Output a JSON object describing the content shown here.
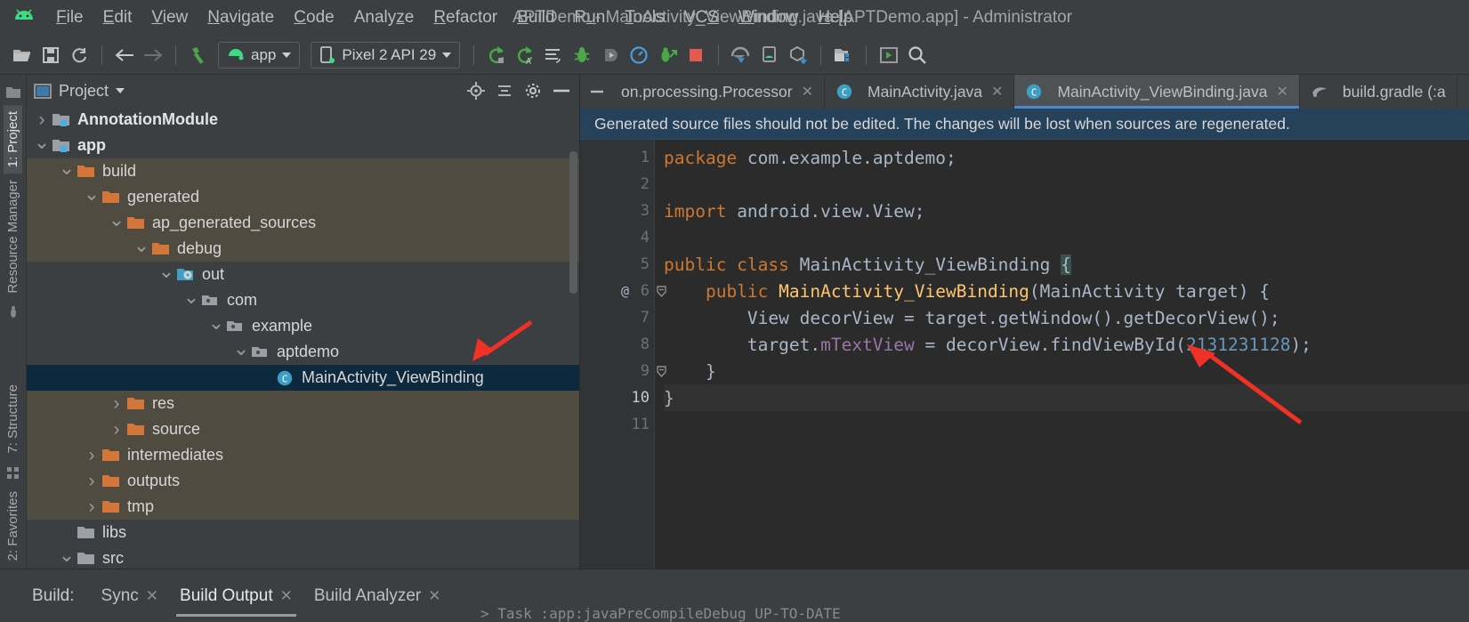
{
  "window": {
    "title": "APTDemo - MainActivity_ViewBinding.java [APTDemo.app] - Administrator",
    "logo_icon": "android-logo-icon"
  },
  "menubar": {
    "items": [
      {
        "label": "File",
        "mnemonic": "F"
      },
      {
        "label": "Edit",
        "mnemonic": "E"
      },
      {
        "label": "View",
        "mnemonic": "V"
      },
      {
        "label": "Navigate",
        "mnemonic": "N"
      },
      {
        "label": "Code",
        "mnemonic": "C"
      },
      {
        "label": "Analyze",
        "mnemonic": "z"
      },
      {
        "label": "Refactor",
        "mnemonic": "R"
      },
      {
        "label": "Build",
        "mnemonic": "B"
      },
      {
        "label": "Run",
        "mnemonic": "u"
      },
      {
        "label": "Tools",
        "mnemonic": "T"
      },
      {
        "label": "VCS",
        "mnemonic": "S"
      },
      {
        "label": "Window",
        "mnemonic": "W"
      },
      {
        "label": "Help",
        "mnemonic": "H"
      }
    ]
  },
  "toolbar": {
    "buttons": [
      {
        "name": "open-project-icon",
        "title": "Open"
      },
      {
        "name": "save-all-icon",
        "title": "Save All"
      },
      {
        "name": "sync-project-icon",
        "title": "Sync Project with Gradle Files"
      },
      {
        "name": "navigate-back-icon",
        "title": "Back"
      },
      {
        "name": "navigate-forward-icon",
        "title": "Forward"
      },
      {
        "name": "build-hammer-icon",
        "title": "Make Project"
      },
      {
        "name": "run-icon",
        "title": "Run"
      },
      {
        "name": "apply-changes-icon",
        "title": "Apply Changes"
      },
      {
        "name": "apply-code-changes-icon",
        "title": "Apply Code Changes"
      },
      {
        "name": "debug-icon",
        "title": "Debug"
      },
      {
        "name": "attach-debugger-icon",
        "title": "Attach Debugger"
      },
      {
        "name": "profiler-icon",
        "title": "Profile"
      },
      {
        "name": "run-with-coverage-icon",
        "title": "Run with Coverage"
      },
      {
        "name": "stop-icon",
        "title": "Stop"
      },
      {
        "name": "avd-manager-icon",
        "title": "AVD Manager"
      },
      {
        "name": "sdk-manager-icon",
        "title": "SDK Manager"
      },
      {
        "name": "gradle-sync-icon",
        "title": "Gradle"
      },
      {
        "name": "project-structure-icon",
        "title": "Project Structure"
      },
      {
        "name": "layout-inspector-icon",
        "title": "Layout Inspector"
      },
      {
        "name": "search-everywhere-icon",
        "title": "Search Everywhere"
      }
    ],
    "module_selector": {
      "label": "app",
      "icon": "android-module-icon"
    },
    "device_selector": {
      "label": "Pixel 2 API 29",
      "icon": "device-icon"
    }
  },
  "left_strip": {
    "tabs": [
      {
        "label": "1: Project",
        "active": true
      },
      {
        "label": "Resource Manager",
        "active": false
      },
      {
        "label": "7: Structure",
        "active": false
      },
      {
        "label": "2: Favorites",
        "active": false
      }
    ]
  },
  "project_panel": {
    "title": "Project",
    "title_icon": "project-view-icon",
    "actions": [
      {
        "name": "locate-icon"
      },
      {
        "name": "collapse-all-icon"
      },
      {
        "name": "settings-gear-icon"
      },
      {
        "name": "hide-panel-icon"
      }
    ],
    "tree": [
      {
        "label": "AnnotationModule",
        "depth": 1,
        "arrow": "right",
        "icon": "module-folder-icon",
        "bold": true,
        "bg": "none",
        "selected": false
      },
      {
        "label": "app",
        "depth": 1,
        "arrow": "down",
        "icon": "module-folder-icon",
        "bold": true,
        "bg": "none",
        "selected": false
      },
      {
        "label": "build",
        "depth": 2,
        "arrow": "down",
        "icon": "orange-folder-icon",
        "bold": false,
        "bg": "olive",
        "selected": false
      },
      {
        "label": "generated",
        "depth": 3,
        "arrow": "down",
        "icon": "orange-folder-icon",
        "bold": false,
        "bg": "olive",
        "selected": false
      },
      {
        "label": "ap_generated_sources",
        "depth": 4,
        "arrow": "down",
        "icon": "orange-folder-icon",
        "bold": false,
        "bg": "olive",
        "selected": false
      },
      {
        "label": "debug",
        "depth": 5,
        "arrow": "down",
        "icon": "orange-folder-icon",
        "bold": false,
        "bg": "olive",
        "selected": false
      },
      {
        "label": "out",
        "depth": 6,
        "arrow": "down",
        "icon": "source-root-folder-icon",
        "bold": false,
        "bg": "none",
        "selected": false
      },
      {
        "label": "com",
        "depth": 7,
        "arrow": "down",
        "icon": "package-folder-icon",
        "bold": false,
        "bg": "none",
        "selected": false
      },
      {
        "label": "example",
        "depth": 8,
        "arrow": "down",
        "icon": "package-folder-icon",
        "bold": false,
        "bg": "none",
        "selected": false
      },
      {
        "label": "aptdemo",
        "depth": 9,
        "arrow": "down",
        "icon": "package-folder-icon",
        "bold": false,
        "bg": "none",
        "selected": false
      },
      {
        "label": "MainActivity_ViewBinding",
        "depth": 10,
        "arrow": "none",
        "icon": "java-class-icon",
        "bold": false,
        "bg": "none",
        "selected": true
      },
      {
        "label": "res",
        "depth": 4,
        "arrow": "right",
        "icon": "orange-folder-icon",
        "bold": false,
        "bg": "olive",
        "selected": false
      },
      {
        "label": "source",
        "depth": 4,
        "arrow": "right",
        "icon": "orange-folder-icon",
        "bold": false,
        "bg": "olive",
        "selected": false
      },
      {
        "label": "intermediates",
        "depth": 3,
        "arrow": "right",
        "icon": "orange-folder-icon",
        "bold": false,
        "bg": "olive",
        "selected": false
      },
      {
        "label": "outputs",
        "depth": 3,
        "arrow": "right",
        "icon": "orange-folder-icon",
        "bold": false,
        "bg": "olive",
        "selected": false
      },
      {
        "label": "tmp",
        "depth": 3,
        "arrow": "right",
        "icon": "orange-folder-icon",
        "bold": false,
        "bg": "olive",
        "selected": false
      },
      {
        "label": "libs",
        "depth": 2,
        "arrow": "none",
        "icon": "gray-folder-icon",
        "bold": false,
        "bg": "none",
        "selected": false
      },
      {
        "label": "src",
        "depth": 2,
        "arrow": "down",
        "icon": "gray-folder-icon",
        "bold": false,
        "bg": "none",
        "selected": false
      }
    ]
  },
  "editor": {
    "tabs": [
      {
        "label": "on.processing.Processor",
        "icon": "none",
        "active": false,
        "closable": true
      },
      {
        "label": "MainActivity.java",
        "icon": "java-class-icon",
        "active": false,
        "closable": true
      },
      {
        "label": "MainActivity_ViewBinding.java",
        "icon": "java-class-icon",
        "active": true,
        "closable": true
      },
      {
        "label": "build.gradle (:a",
        "icon": "gradle-icon",
        "active": false,
        "closable": false
      }
    ],
    "banner": "Generated source files should not be edited. The changes will be lost when sources are regenerated.",
    "lines": [
      {
        "num": "1",
        "annotation": "",
        "fold": false,
        "current": false,
        "tokens": [
          {
            "t": "package ",
            "c": "kw"
          },
          {
            "t": "com.example.aptdemo;",
            "c": "plain"
          }
        ]
      },
      {
        "num": "2",
        "annotation": "",
        "fold": false,
        "current": false,
        "tokens": []
      },
      {
        "num": "3",
        "annotation": "",
        "fold": false,
        "current": false,
        "tokens": [
          {
            "t": "import ",
            "c": "kw"
          },
          {
            "t": "android.view.View;",
            "c": "plain"
          }
        ]
      },
      {
        "num": "4",
        "annotation": "",
        "fold": false,
        "current": false,
        "tokens": []
      },
      {
        "num": "5",
        "annotation": "",
        "fold": false,
        "current": false,
        "tokens": [
          {
            "t": "public class ",
            "c": "kw"
          },
          {
            "t": "MainActivity_ViewBinding ",
            "c": "plain"
          },
          {
            "t": "{",
            "c": "brace-hl"
          }
        ]
      },
      {
        "num": "6",
        "annotation": "@",
        "fold": true,
        "current": false,
        "tokens": [
          {
            "t": "    ",
            "c": "plain"
          },
          {
            "t": "public ",
            "c": "kw"
          },
          {
            "t": "MainActivity_ViewBinding",
            "c": "fn"
          },
          {
            "t": "(MainActivity target) {",
            "c": "plain"
          }
        ]
      },
      {
        "num": "7",
        "annotation": "",
        "fold": false,
        "current": false,
        "tokens": [
          {
            "t": "        View decorView = target.getWindow().getDecorView();",
            "c": "plain"
          }
        ]
      },
      {
        "num": "8",
        "annotation": "",
        "fold": false,
        "current": false,
        "tokens": [
          {
            "t": "        target.",
            "c": "plain"
          },
          {
            "t": "mTextView",
            "c": "fld"
          },
          {
            "t": " = decorView.findViewById(",
            "c": "plain"
          },
          {
            "t": "2131231128",
            "c": "num"
          },
          {
            "t": ");",
            "c": "plain"
          }
        ]
      },
      {
        "num": "9",
        "annotation": "",
        "fold": true,
        "current": false,
        "tokens": [
          {
            "t": "    }",
            "c": "plain"
          }
        ]
      },
      {
        "num": "10",
        "annotation": "",
        "fold": false,
        "current": true,
        "tokens": [
          {
            "t": "}",
            "c": "plain"
          }
        ]
      },
      {
        "num": "11",
        "annotation": "",
        "fold": false,
        "current": false,
        "tokens": []
      }
    ]
  },
  "build_panel": {
    "label": "Build:",
    "tabs": [
      {
        "label": "Sync",
        "active": false,
        "closable": true
      },
      {
        "label": "Build Output",
        "active": true,
        "closable": true
      },
      {
        "label": "Build Analyzer",
        "active": false,
        "closable": true
      }
    ]
  },
  "colors": {
    "accent_blue": "#4a88c7",
    "selection_blue": "#0d293e",
    "banner_blue": "#26425b",
    "olive_row": "#4f4b41",
    "orange_folder": "#d4763a",
    "keyword_orange": "#cc7832",
    "method_yellow": "#ffc66d",
    "number_blue": "#6897bb",
    "field_purple": "#9876aa",
    "annotation_red": "#f03125",
    "stop_red": "#e05c50",
    "android_green": "#3ddc84",
    "panel_bg": "#3c3f41",
    "editor_bg": "#2b2b2b",
    "gutter_bg": "#313335"
  }
}
